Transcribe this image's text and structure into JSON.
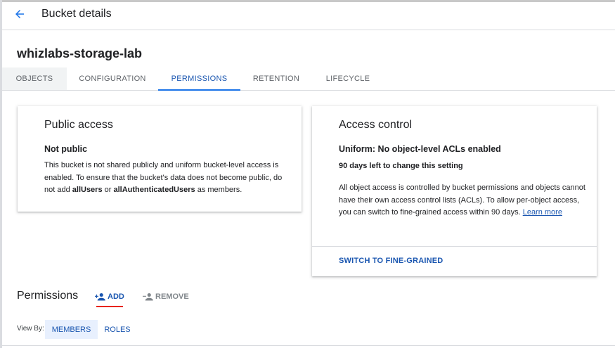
{
  "header": {
    "back_icon": "arrow-back-icon",
    "title": "Bucket details"
  },
  "bucket": {
    "name": "whizlabs-storage-lab"
  },
  "tabs": [
    {
      "label": "OBJECTS",
      "active": false
    },
    {
      "label": "CONFIGURATION",
      "active": false
    },
    {
      "label": "PERMISSIONS",
      "active": true
    },
    {
      "label": "RETENTION",
      "active": false
    },
    {
      "label": "LIFECYCLE",
      "active": false
    }
  ],
  "public_access": {
    "title": "Public access",
    "status": "Not public",
    "description_1": "This bucket is not shared publicly and uniform bucket-level access is enabled. To ensure that the bucket's data does not become public, do not add ",
    "all_users": "allUsers",
    "description_or": " or ",
    "all_authenticated_users": "allAuthenticatedUsers",
    "description_2": " as members."
  },
  "access_control": {
    "title": "Access control",
    "mode": "Uniform: No object-level ACLs enabled",
    "days_note": "90 days left to change this setting",
    "description": "All object access is controlled by bucket permissions and objects cannot have their own access control lists (ACLs). To allow per-object access, you can switch to fine-grained access within 90 days. ",
    "learn_more": "Learn more",
    "switch_label": "SWITCH TO FINE-GRAINED"
  },
  "permissions": {
    "title": "Permissions",
    "add_label": "ADD",
    "add_icon": "person-add-icon",
    "remove_label": "REMOVE",
    "remove_icon": "person-remove-icon",
    "view_by_label": "View By:",
    "view_by_options": [
      {
        "label": "MEMBERS",
        "selected": true
      },
      {
        "label": "ROLES",
        "selected": false
      }
    ]
  },
  "colors": {
    "accent": "#1a73e8",
    "link": "#1a56b0",
    "highlight_underline": "#e8231c"
  }
}
